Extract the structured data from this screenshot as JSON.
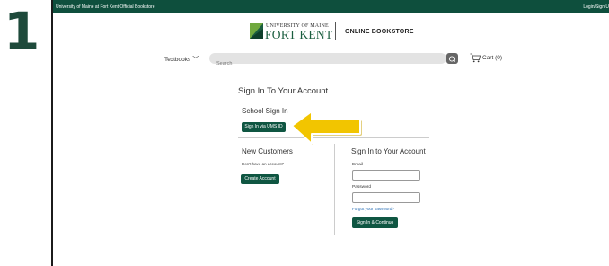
{
  "step": {
    "number": "1"
  },
  "topbar": {
    "site_label": "University of Maine at Fort Kent Official Bookstore",
    "login_label": "Login/Sign U"
  },
  "header": {
    "logo_university": "UNIVERSITY OF MAINE",
    "logo_campus": "FORT KENT",
    "store_title": "ONLINE BOOKSTORE"
  },
  "nav": {
    "textbooks_label": "Textbooks",
    "search_placeholder": "Search",
    "cart_label": "Cart (0)"
  },
  "main": {
    "heading": "Sign In To Your Account",
    "school_signin": {
      "title": "School Sign In",
      "button_label": "Sign In via UMS ID"
    },
    "new_customers": {
      "title": "New Customers",
      "prompt": "Don't have an account?",
      "button_label": "Create Account"
    },
    "signin": {
      "title": "Sign In to Your Account",
      "email_label": "Email",
      "email_value": "",
      "password_label": "Password",
      "password_value": "",
      "forgot_label": "Forgot your password?",
      "button_label": "Sign In & Continue"
    }
  },
  "colors": {
    "brand_green": "#0f5642",
    "arrow_yellow": "#f2c500",
    "step_number": "#1e4a3b",
    "link_blue": "#2a6fb5"
  }
}
